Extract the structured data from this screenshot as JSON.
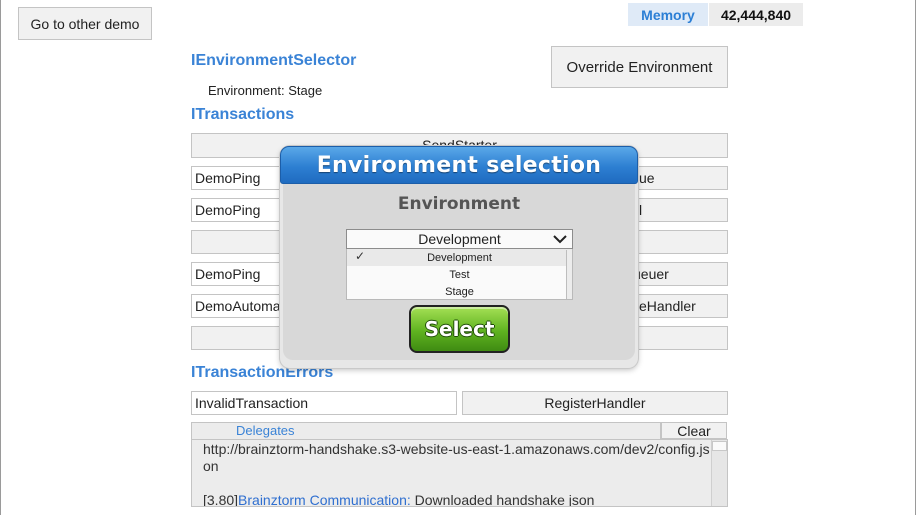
{
  "top": {
    "go_other_demo": "Go to other demo",
    "memory_label": "Memory",
    "memory_value": "42,444,840"
  },
  "env_selector": {
    "heading": "IEnvironmentSelector",
    "env_text": "Environment: Stage",
    "override_button": "Override Environment"
  },
  "transactions": {
    "heading": "ITransactions",
    "send_starter": "SendStarter",
    "rows": [
      {
        "field": "DemoPing",
        "right_visible": "ue"
      },
      {
        "field": "DemoPing",
        "right_visible": "l"
      },
      {
        "field": "DemoPing",
        "right_visible": "ueuer"
      },
      {
        "field": "DemoAutoma",
        "right_visible": "eHandler"
      }
    ]
  },
  "transaction_errors": {
    "heading": "ITransactionErrors",
    "field": "InvalidTransaction",
    "register_handler": "RegisterHandler"
  },
  "log": {
    "tab_label": "Delegates",
    "clear_button": "Clear",
    "line1": "http://brainztorm-handshake.s3-website-us-east-1.amazonaws.com/dev2/config.json",
    "line2_prefix": "[3.80]",
    "line2_link": "Brainztorm Communication:",
    "line2_suffix": " Downloaded handshake json"
  },
  "modal": {
    "title": "Environment selection",
    "subtitle": "Environment",
    "dropdown_selected": "Development",
    "options": [
      "Development",
      "Test",
      "Stage"
    ],
    "selected_index": 0,
    "check_glyph": "✓",
    "select_button": "Select"
  },
  "colors": {
    "accent_blue": "#3a83d6",
    "modal_header": "#2d7fd2",
    "select_green": "#5fb320"
  }
}
